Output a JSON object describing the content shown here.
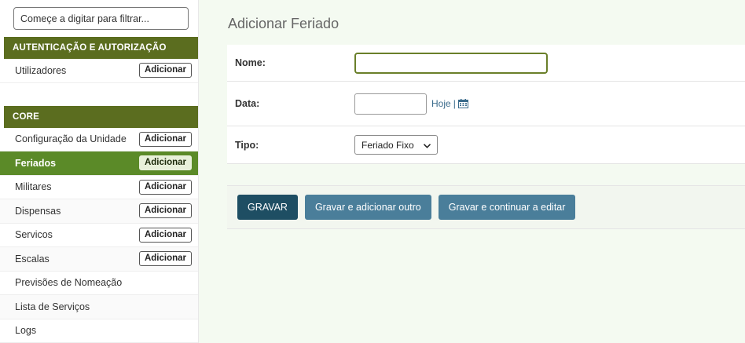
{
  "sidebar": {
    "filter_placeholder": "Começe a digitar para filtrar...",
    "modules": [
      {
        "caption": "Autenticação e Autorização",
        "items": [
          {
            "label": "Utilizadores",
            "add": "Adicionar"
          }
        ]
      },
      {
        "caption": "Core",
        "items": [
          {
            "label": "Configuração da Unidade",
            "add": "Adicionar"
          },
          {
            "label": "Feriados",
            "add": "Adicionar"
          },
          {
            "label": "Militares",
            "add": "Adicionar"
          },
          {
            "label": "Dispensas",
            "add": "Adicionar"
          },
          {
            "label": "Servicos",
            "add": "Adicionar"
          },
          {
            "label": "Escalas",
            "add": "Adicionar"
          },
          {
            "label": "Previsões de Nomeação"
          },
          {
            "label": "Lista de Serviços"
          },
          {
            "label": "Logs"
          }
        ]
      }
    ],
    "active_item": "Feriados"
  },
  "main": {
    "title": "Adicionar Feriado",
    "fields": {
      "nome_label": "Nome:",
      "nome_value": "",
      "data_label": "Data:",
      "data_value": "",
      "hoje_link": "Hoje",
      "separator": "|",
      "tipo_label": "Tipo:",
      "tipo_selected": "Feriado Fixo"
    },
    "buttons": {
      "save": "GRAVAR",
      "save_add": "Gravar e adicionar outro",
      "save_continue": "Gravar e continuar a editar"
    }
  },
  "colors": {
    "module_header": "#5b6d1f",
    "active_row": "#5b8a28",
    "primary_button": "#1e4e63",
    "secondary_button": "#4a7e9a",
    "link": "#3a6b8c"
  },
  "icons": {
    "calendar": "calendar-icon",
    "select_arrow": "chevron-down-icon"
  }
}
